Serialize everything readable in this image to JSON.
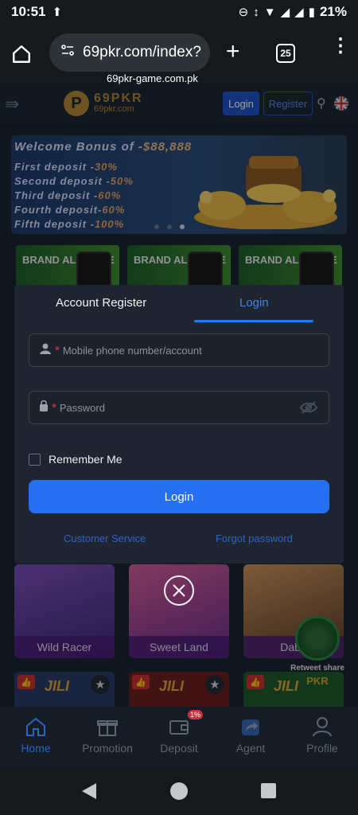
{
  "status_bar": {
    "time": "10:51",
    "battery_percent": "21%"
  },
  "browser": {
    "url": "69pkr.com/index?",
    "tab_count": "25",
    "url_tooltip": "69pkr-game.com.pk"
  },
  "site_header": {
    "logo_text": "69PKR",
    "logo_sub": "69pkr.com",
    "login_label": "Login",
    "register_label": "Register"
  },
  "banner": {
    "title": "Welcome Bonus of -",
    "amount": "$88,888",
    "lines": [
      {
        "label": "First deposit -",
        "pct": "30%"
      },
      {
        "label": "Second deposit -",
        "pct": "50%"
      },
      {
        "label": "Third deposit -",
        "pct": "60%"
      },
      {
        "label": "Fourth deposit-",
        "pct": "60%"
      },
      {
        "label": "Fifth deposit -",
        "pct": "100%"
      }
    ]
  },
  "brand_cards": [
    {
      "label": "BRAND ALLIANCE"
    },
    {
      "label": "BRAND ALLIANCE"
    },
    {
      "label": "BRAND ALLIANCE"
    }
  ],
  "modal": {
    "tab_register": "Account Register",
    "tab_login": "Login",
    "account_placeholder": "Mobile phone number/account",
    "password_placeholder": "Password",
    "remember_label": "Remember Me",
    "login_button": "Login",
    "customer_service": "Customer Service",
    "forgot_password": "Forgot password"
  },
  "games": [
    {
      "name": "Wild Racer"
    },
    {
      "name": "Sweet Land"
    },
    {
      "name": "Daba"
    }
  ],
  "jili_cards": [
    {
      "label": "JILI"
    },
    {
      "label": "JILI"
    },
    {
      "label": "JILI"
    }
  ],
  "share_badge": {
    "text": "Retweet share",
    "sub": "PKR"
  },
  "bottom_nav": {
    "items": [
      {
        "label": "Home"
      },
      {
        "label": "Promotion"
      },
      {
        "label": "Deposit"
      },
      {
        "label": "Agent"
      },
      {
        "label": "Profile"
      }
    ],
    "deposit_badge": "1%"
  },
  "colors": {
    "accent": "#2470f0",
    "active_nav": "#2c63c9",
    "required": "#e03a3a"
  }
}
